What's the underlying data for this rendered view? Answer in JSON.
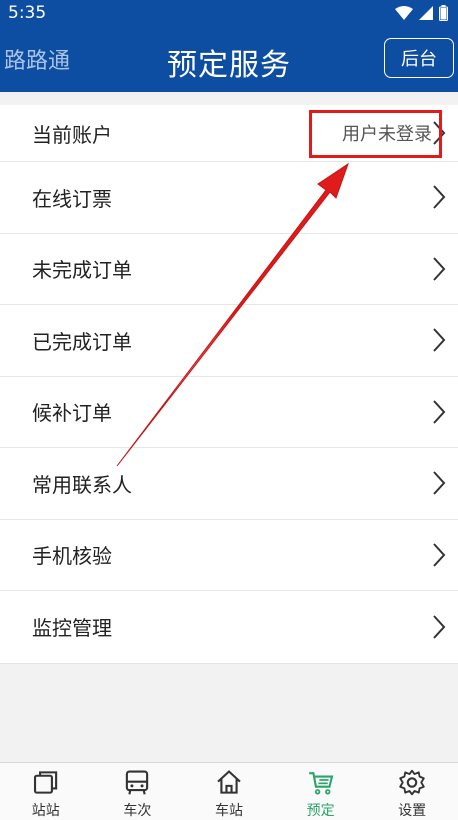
{
  "status_bar": {
    "time": "5:35"
  },
  "header": {
    "app_name": "路路通",
    "title": "预定服务",
    "backend_button": "后台"
  },
  "menu": {
    "items": [
      {
        "label": "当前账户",
        "value": "用户未登录"
      },
      {
        "label": "在线订票"
      },
      {
        "label": "未完成订单"
      },
      {
        "label": "已完成订单"
      },
      {
        "label": "候补订单"
      },
      {
        "label": "常用联系人"
      },
      {
        "label": "手机核验"
      },
      {
        "label": "监控管理"
      }
    ]
  },
  "tabbar": {
    "tabs": [
      {
        "label": "站站",
        "icon": "station-to-station-icon"
      },
      {
        "label": "车次",
        "icon": "bus-icon"
      },
      {
        "label": "车站",
        "icon": "home-icon"
      },
      {
        "label": "预定",
        "icon": "cart-icon",
        "active": true
      },
      {
        "label": "设置",
        "icon": "gear-icon"
      }
    ]
  },
  "colors": {
    "header_bg": "#0d4ea3",
    "active_tab": "#2aa46a",
    "annotation_red": "#e01b1b"
  }
}
